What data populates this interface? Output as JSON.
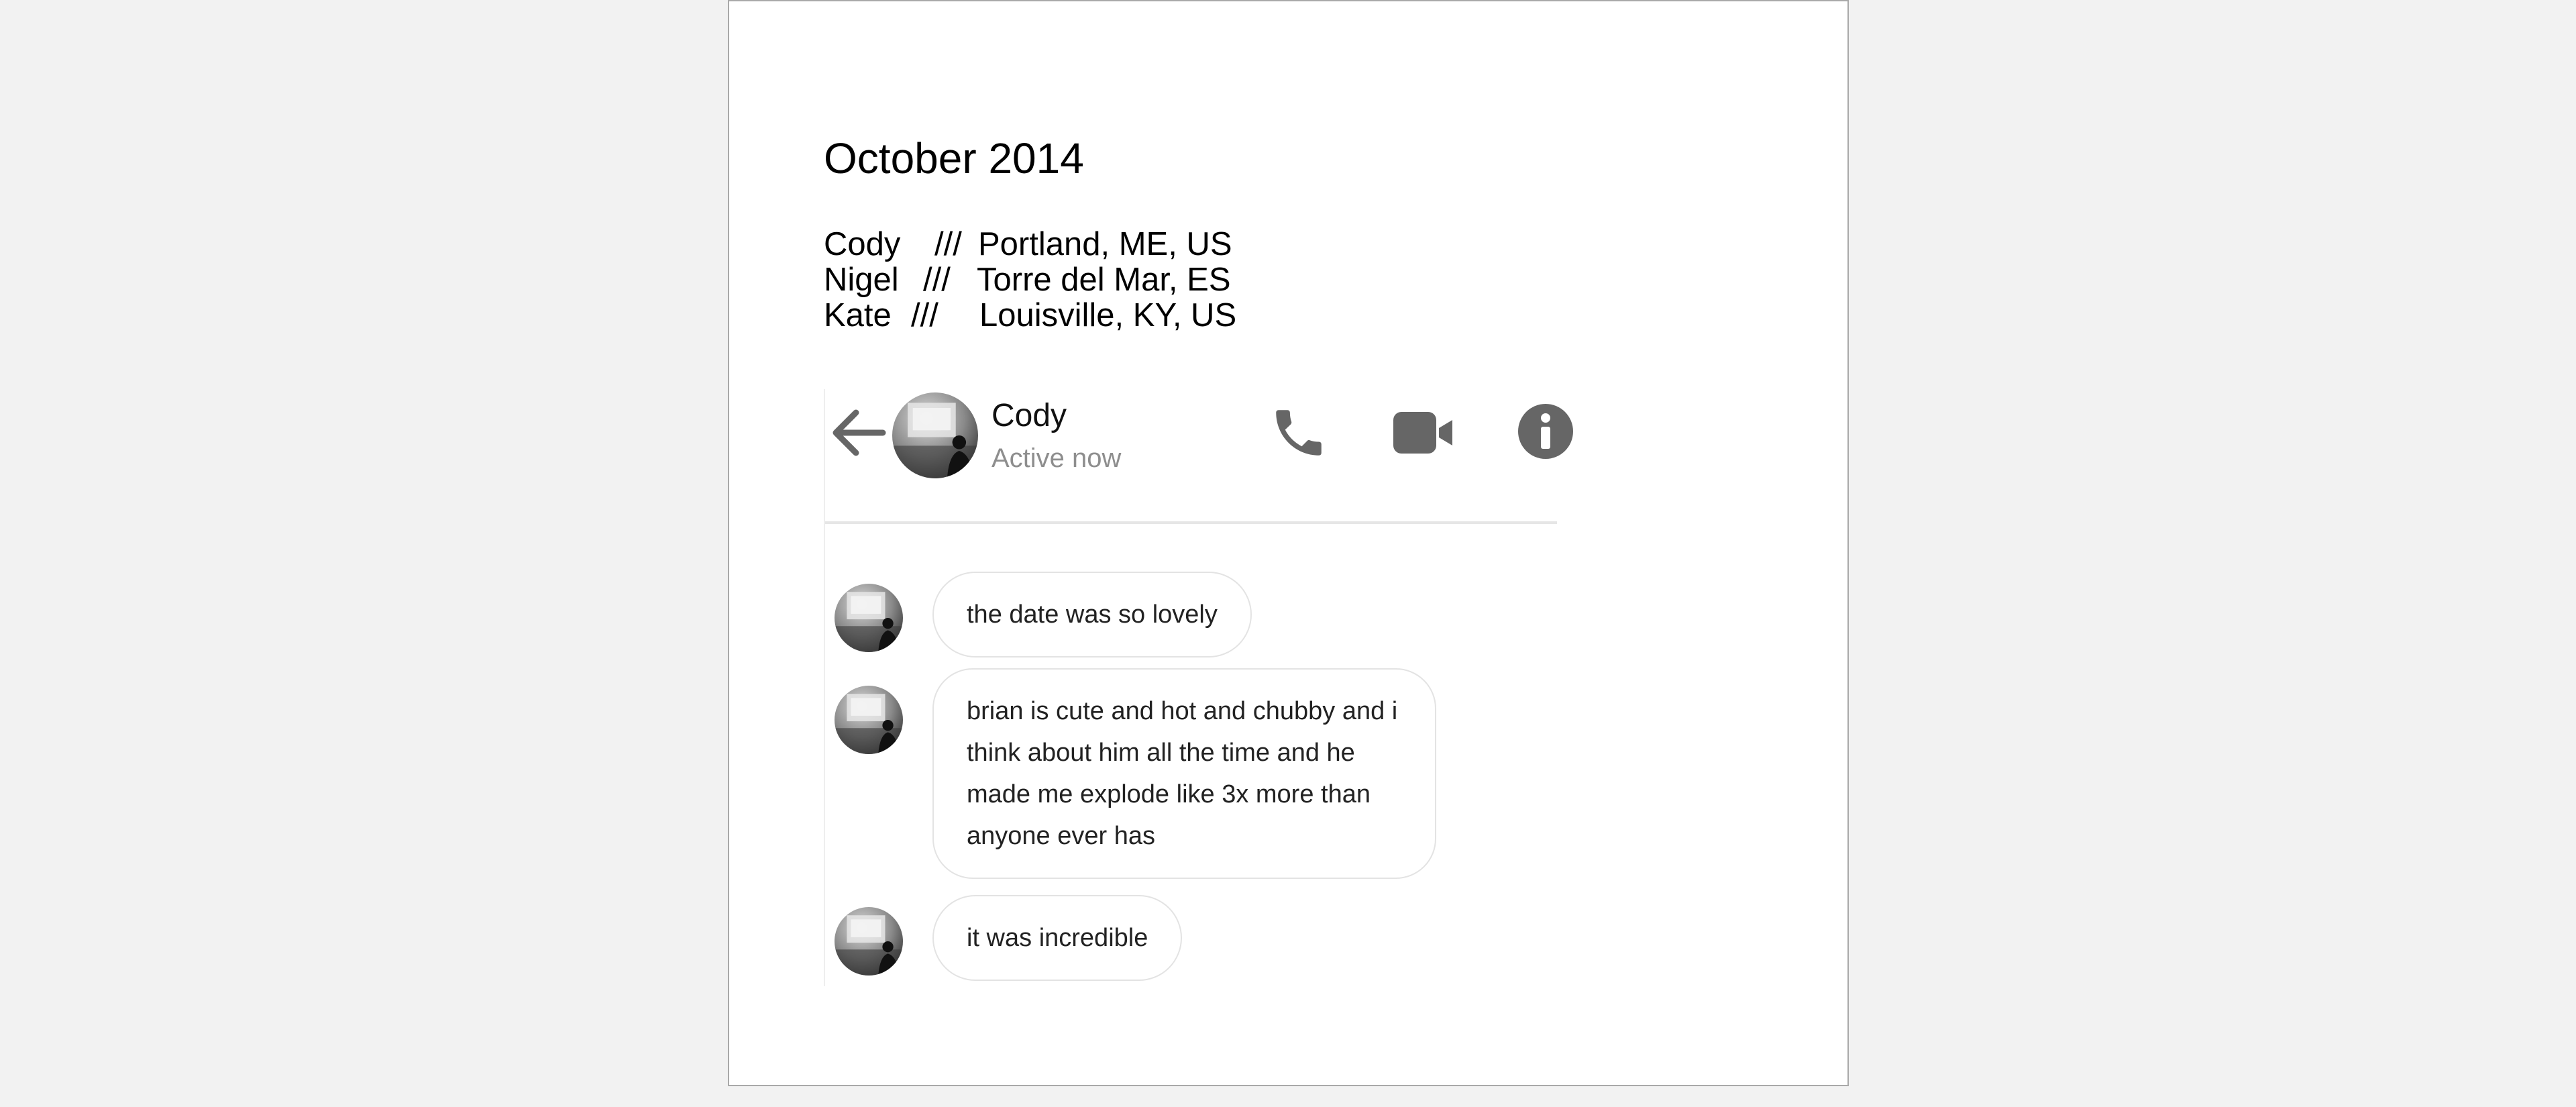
{
  "document": {
    "heading": "October 2014",
    "roster": [
      {
        "name": "Cody",
        "sep": "///",
        "place": "Portland, ME, US"
      },
      {
        "name": "Nigel",
        "sep": "///",
        "place": "Torre del Mar, ES"
      },
      {
        "name": "Kate",
        "sep": "///",
        "place": "Louisville, KY, US"
      }
    ]
  },
  "chat": {
    "contact_name": "Cody",
    "status": "Active now",
    "icons": {
      "back": "arrow-left-icon",
      "call": "phone-icon",
      "video": "video-camera-icon",
      "info": "info-icon"
    },
    "icon_color": "#666666",
    "messages": [
      {
        "text": "the date was so lovely"
      },
      {
        "text": "brian is cute and hot and chubby and i think about him all the time and he made me explode like 3x more than anyone ever has"
      },
      {
        "text": "it was incredible"
      }
    ]
  }
}
